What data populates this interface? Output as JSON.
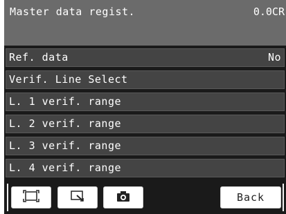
{
  "header": {
    "title": "Master data regist.",
    "value": "0.0CR"
  },
  "menu": {
    "items": [
      {
        "label": "Ref. data",
        "value": "No"
      },
      {
        "label": "Verif. Line Select",
        "value": ""
      },
      {
        "label": "L. 1 verif. range",
        "value": ""
      },
      {
        "label": "L. 2 verif. range",
        "value": ""
      },
      {
        "label": "L. 3 verif. range",
        "value": ""
      },
      {
        "label": "L. 4 verif. range",
        "value": ""
      }
    ]
  },
  "toolbar": {
    "back_label": "Back",
    "icons": [
      "fit-screen-icon",
      "zoom-icon",
      "camera-icon"
    ]
  },
  "colors": {
    "background": "#1a1a1a",
    "header": "#6b6b6b",
    "item": "#444444",
    "button": "#ffffff"
  }
}
